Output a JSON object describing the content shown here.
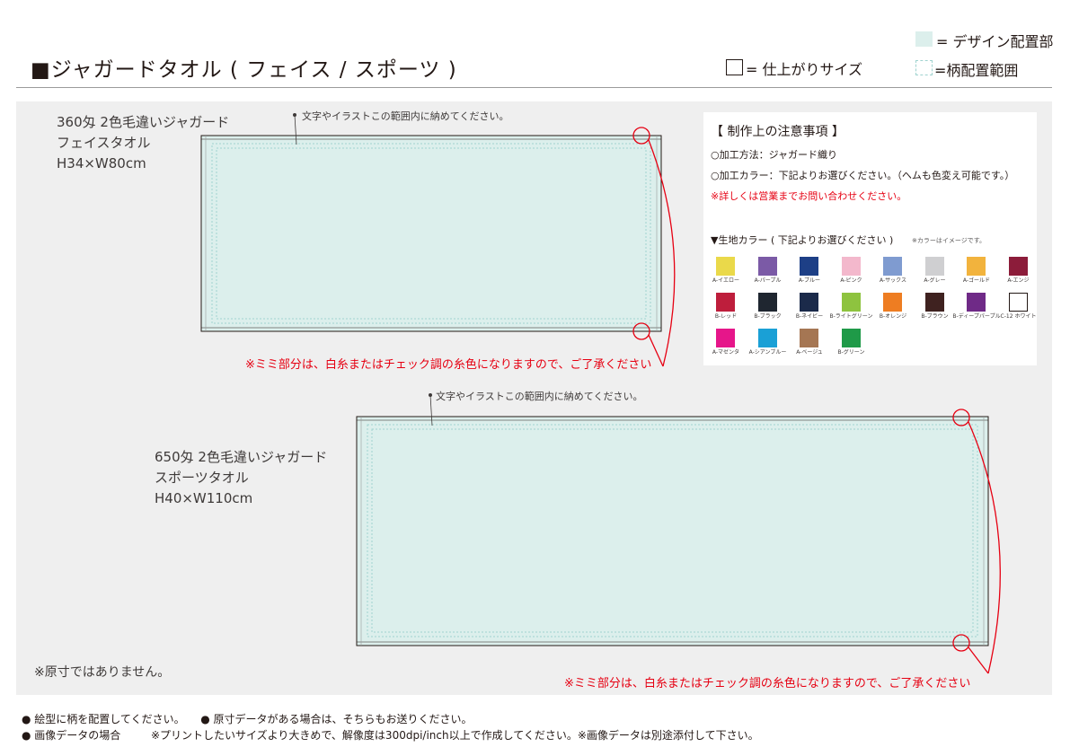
{
  "header": {
    "title": "■ジャガードタオル ( フェイス / スポーツ )",
    "legend_design": "= デザイン配置部",
    "legend_area": "=柄配置範囲",
    "legend_size": "= 仕上がりサイズ"
  },
  "colors": {
    "design_area": "#dcefec",
    "dash": "#9fd3cf",
    "warning": "#e60012",
    "panel": "#efefef"
  },
  "face_towel": {
    "line1": "360匁 2色毛違いジャガード",
    "line2": "フェイスタオル",
    "line3": "H34×W80cm",
    "hint": "文字やイラストこの範囲内に納めてください。",
    "warning": "※ミミ部分は、白糸またはチェック調の糸色になりますので、ご了承ください"
  },
  "sports_towel": {
    "line1": "650匁 2色毛違いジャガード",
    "line2": "スポーツタオル",
    "line3": "H40×W110cm",
    "hint": "文字やイラストこの範囲内に納めてください。",
    "warning": "※ミミ部分は、白糸またはチェック調の糸色になりますので、ご了承ください"
  },
  "scale_note": "※原寸ではありません。",
  "notes": {
    "title": "【 制作上の注意事項 】",
    "method": "○加工方法：ジャガード織り",
    "color": "○加工カラー：下記よりお選びください。（ヘムも色変え可能です。）",
    "contact": "※詳しくは営業までお問い合わせください。",
    "fabric_title": "▼生地カラー ( 下記よりお選びください )",
    "fabric_note": "※カラーはイメージです。"
  },
  "fabric_colors": [
    {
      "name": "A-イエロー",
      "hex": "#ead94a"
    },
    {
      "name": "A-パープル",
      "hex": "#7b5aa6"
    },
    {
      "name": "A-ブルー",
      "hex": "#1d3f86"
    },
    {
      "name": "A-ピンク",
      "hex": "#f3b8cc"
    },
    {
      "name": "A-サックス",
      "hex": "#7f9bd0"
    },
    {
      "name": "A-グレー",
      "hex": "#cfcfd1"
    },
    {
      "name": "A-ゴールド",
      "hex": "#f2b33d"
    },
    {
      "name": "A-エンジ",
      "hex": "#8c1c3a"
    },
    {
      "name": "B-レッド",
      "hex": "#be1e3c"
    },
    {
      "name": "B-ブラック",
      "hex": "#1f2630"
    },
    {
      "name": "B-ネイビー",
      "hex": "#1b2a4a"
    },
    {
      "name": "B-ライトグリーン",
      "hex": "#8ec33f"
    },
    {
      "name": "B-オレンジ",
      "hex": "#ee7d22"
    },
    {
      "name": "B-ブラウン",
      "hex": "#3f2220"
    },
    {
      "name": "B-ディープパープル",
      "hex": "#6f2a87"
    },
    {
      "name": "C-12 ホワイト",
      "hex": "#ffffff"
    },
    {
      "name": "A-マゼンタ",
      "hex": "#e6168a"
    },
    {
      "name": "A-シアンブルー",
      "hex": "#1aa0d6"
    },
    {
      "name": "A-ベージュ",
      "hex": "#a57653"
    },
    {
      "name": "B-グリーン",
      "hex": "#1f9a48"
    }
  ],
  "footer": {
    "line1a": "● 絵型に柄を配置してください。",
    "line1b": "● 原寸データがある場合は、そちらもお送りください。",
    "line2a": "● 画像データの場合",
    "line2b": "※プリントしたいサイズより大きめで、解像度は300dpi/inch以上で作成してください。※画像データは別途添付して下さい。"
  }
}
